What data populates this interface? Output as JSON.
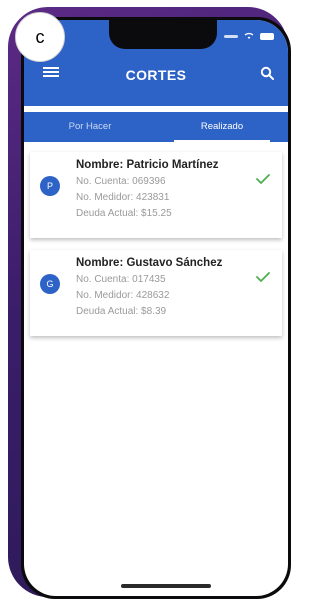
{
  "figure_label": "c",
  "appbar": {
    "title": "CORTES"
  },
  "tabs": [
    {
      "label": "Por Hacer",
      "active": false
    },
    {
      "label": "Realizado",
      "active": true
    }
  ],
  "cards": [
    {
      "avatar": "P",
      "name": "Nombre: Patricio Martínez",
      "account": "No. Cuenta: 069396",
      "meter": "No. Medidor: 423831",
      "debt": "Deuda Actual: $15.25",
      "status": "check-icon"
    },
    {
      "avatar": "G",
      "name": "Nombre: Gustavo Sánchez",
      "account": "No. Cuenta: 017435",
      "meter": "No. Medidor: 428632",
      "debt": "Deuda Actual: $8.39",
      "status": "check-icon"
    }
  ],
  "colors": {
    "primary": "#2d62c7",
    "check": "#4caf50"
  }
}
